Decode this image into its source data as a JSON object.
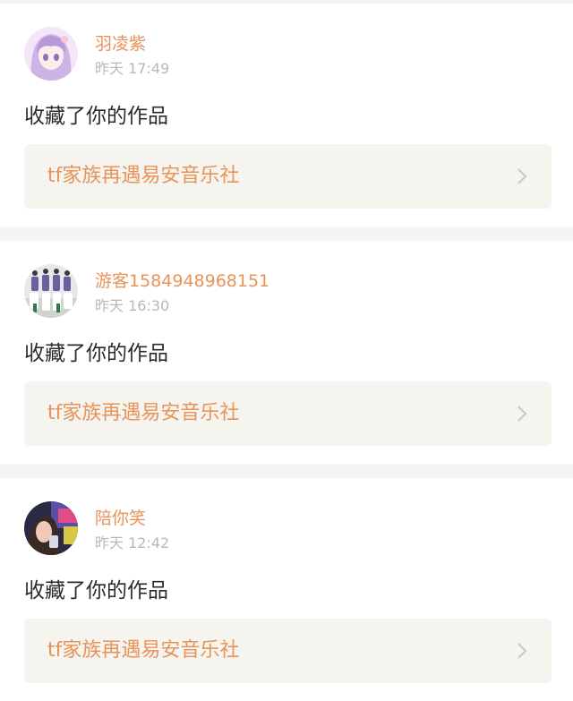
{
  "theme": {
    "accent": "#e8935a",
    "time_color": "#b8b8b8",
    "card_bg": "#ffffff",
    "page_bg": "#f5f5f5",
    "link_bg": "#f5f4ee",
    "chevron_color": "#c8c8c8"
  },
  "notifications": [
    {
      "username": "羽凌紫",
      "time": "昨天 17:49",
      "action": "收藏了你的作品",
      "work_title": "tf家族再遇易安音乐社",
      "avatar_icon": "anime-girl-avatar"
    },
    {
      "username": "游客1584948968151",
      "time": "昨天 16:30",
      "action": "收藏了你的作品",
      "work_title": "tf家族再遇易安音乐社",
      "avatar_icon": "group-photo-avatar"
    },
    {
      "username": "陪你笑",
      "time": "昨天 12:42",
      "action": "收藏了你的作品",
      "work_title": "tf家族再遇易安音乐社",
      "avatar_icon": "selfie-photo-avatar"
    }
  ]
}
